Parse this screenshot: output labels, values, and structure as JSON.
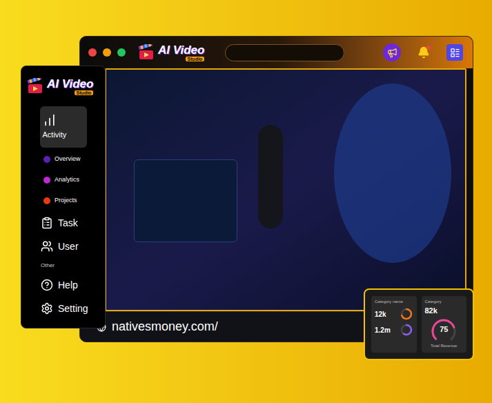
{
  "window": {
    "url": "nativesmoney.com/",
    "logo": {
      "title": "AI Video",
      "subtitle": "Studio"
    },
    "notifications": {
      "unread": true
    }
  },
  "sidebar": {
    "logo": {
      "title": "AI Video",
      "subtitle": "Studio"
    },
    "items": [
      {
        "kind": "main",
        "label": "Activity",
        "selected": true
      },
      {
        "kind": "sub",
        "label": "Overview",
        "color": "#5b21b6",
        "selected": false
      },
      {
        "kind": "sub",
        "label": "Analytics",
        "color": "#c026d3",
        "selected": false
      },
      {
        "kind": "sub",
        "label": "Projects",
        "color": "#ea3a0c",
        "selected": false
      },
      {
        "kind": "main",
        "label": "Task",
        "selected": false
      },
      {
        "kind": "main",
        "label": "User",
        "selected": false
      },
      {
        "kind": "section",
        "label": "Other"
      },
      {
        "kind": "main",
        "label": "Help",
        "selected": false
      },
      {
        "kind": "main",
        "label": "Setting",
        "selected": false
      }
    ]
  },
  "stats": {
    "left": {
      "title": "Category name",
      "rows": [
        {
          "value": "12k",
          "level": 0.7,
          "color": "#f97316"
        },
        {
          "value": "1.2m",
          "level": 0.6,
          "color": "#8b5cf6"
        }
      ]
    },
    "right": {
      "title": "Category",
      "value": "82k",
      "gauge": {
        "value": "75",
        "level": 0.75
      },
      "caption": "Total Revenue"
    }
  }
}
